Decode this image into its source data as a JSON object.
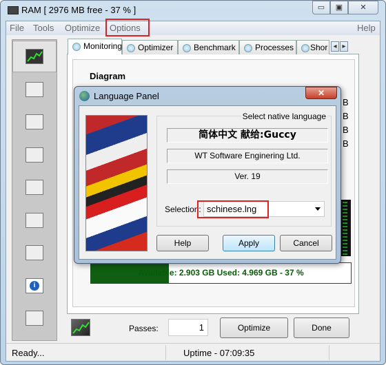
{
  "window": {
    "title": "RAM [ 2976 MB free - 37 % ]",
    "minimize": "▭",
    "maximize": "▣",
    "close": "✕"
  },
  "menu": {
    "items": [
      "File",
      "Tools",
      "Optimize",
      "Options"
    ],
    "help": "Help"
  },
  "sidebar": {
    "icons": [
      "monitoring-icon",
      "list-icon",
      "memory-chip-icon",
      "gears-icon",
      "shortcut-icon",
      "checklist-icon",
      "settings-list-icon",
      "info-icon",
      "mail-icon"
    ]
  },
  "tabs": [
    "Monitoring",
    "Optimizer",
    "Benchmark",
    "Processes",
    "Shor"
  ],
  "tab_scroll": {
    "left": "◂",
    "right": "▸"
  },
  "monitoring": {
    "diagram_label": "Diagram",
    "stat_units": [
      "B",
      "B",
      "B",
      "B"
    ],
    "usage": {
      "text": "Available: 2.903 GB  Used: 4.969 GB - 37 %",
      "available_percent": 30
    }
  },
  "dialog": {
    "title": "Language Panel",
    "close": "✕",
    "caption": "Select native language",
    "language_name": "简体中文  献给:Guccy",
    "company": "WT Software Enginering Ltd.",
    "version": "Ver. 19",
    "selection_label": "Selection:",
    "selection_value": "schinese.lng",
    "buttons": {
      "help": "Help",
      "apply": "Apply",
      "cancel": "Cancel"
    }
  },
  "bottom": {
    "passes_label": "Passes:",
    "passes_value": "1",
    "optimize": "Optimize",
    "done": "Done"
  },
  "status": {
    "left": "Ready...",
    "uptime": "Uptime - 07:09:35"
  },
  "colors": {
    "highlight": "#e02020",
    "usage_fill": "#0f5e12",
    "usage_text": "#0a5a0a"
  }
}
